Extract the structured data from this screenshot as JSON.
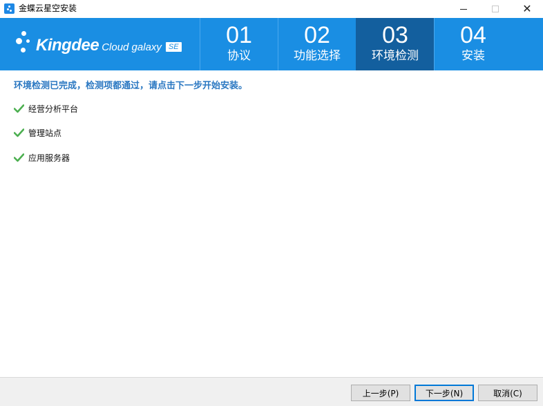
{
  "window": {
    "title": "金蝶云星空安装"
  },
  "logo": {
    "brand": "Kingdee",
    "sub": "Cloud galaxy",
    "edition": "SE"
  },
  "steps": [
    {
      "num": "01",
      "label": "协议",
      "active": false
    },
    {
      "num": "02",
      "label": "功能选择",
      "active": false
    },
    {
      "num": "03",
      "label": "环境检测",
      "active": true
    },
    {
      "num": "04",
      "label": "安装",
      "active": false
    }
  ],
  "content": {
    "headline": "环境检测已完成，检测项都通过，请点击下一步开始安装。",
    "checks": [
      {
        "label": "经营分析平台",
        "status": "passed"
      },
      {
        "label": "管理站点",
        "status": "passed"
      },
      {
        "label": "应用服务器",
        "status": "passed"
      }
    ]
  },
  "footer": {
    "prev_label": "上一步(P)",
    "next_label": "下一步(N)",
    "cancel_label": "取消(C)"
  },
  "colors": {
    "banner": "#1a8ee3",
    "active_step": "#135f9e",
    "headline": "#2b78c2",
    "check": "#4caf50"
  },
  "icons": {
    "app": "kingdee-app-icon",
    "check": "checkmark-icon",
    "minimize": "minimize-icon",
    "maximize": "maximize-icon",
    "close": "close-icon"
  }
}
